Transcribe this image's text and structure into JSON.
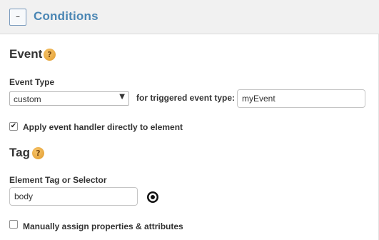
{
  "header": {
    "collapse_symbol": "–",
    "title": "Conditions"
  },
  "event": {
    "title": "Event",
    "help_symbol": "?",
    "event_type_label": "Event Type",
    "event_type_value": "custom",
    "triggered_label": "for triggered event type:",
    "triggered_value": "myEvent",
    "apply_checked": true,
    "apply_label": "Apply event handler directly to element"
  },
  "tag": {
    "title": "Tag",
    "help_symbol": "?",
    "selector_label": "Element Tag or Selector",
    "selector_value": "body",
    "manual_checked": false,
    "manual_label": "Manually assign properties & attributes"
  },
  "icons": {
    "collapse": "minus-icon",
    "help": "question-mark-icon",
    "dropdown": "chevron-down-icon",
    "target": "target-icon",
    "checkmark": "checkmark-icon"
  },
  "colors": {
    "accent": "#4a86b4",
    "help": "#e09b2d",
    "header_bg": "#f1f1f1"
  }
}
